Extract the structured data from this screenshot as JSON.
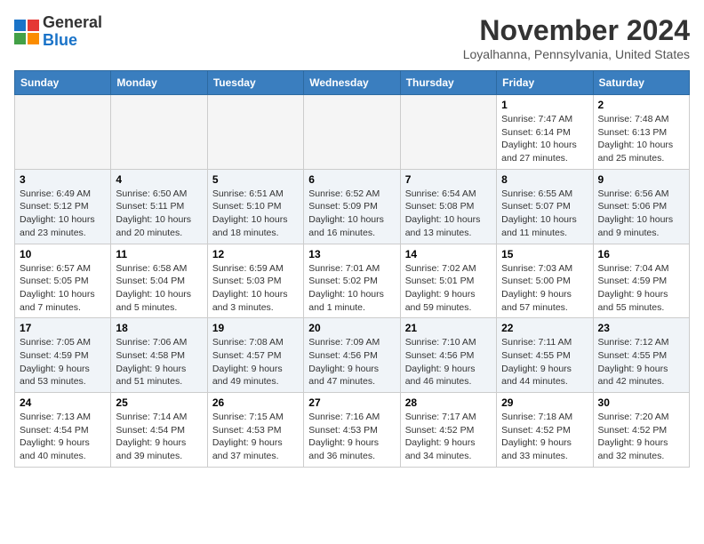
{
  "logo": {
    "general": "General",
    "blue": "Blue"
  },
  "header": {
    "month": "November 2024",
    "location": "Loyalhanna, Pennsylvania, United States"
  },
  "weekdays": [
    "Sunday",
    "Monday",
    "Tuesday",
    "Wednesday",
    "Thursday",
    "Friday",
    "Saturday"
  ],
  "weeks": [
    [
      {
        "day": "",
        "empty": true
      },
      {
        "day": "",
        "empty": true
      },
      {
        "day": "",
        "empty": true
      },
      {
        "day": "",
        "empty": true
      },
      {
        "day": "",
        "empty": true
      },
      {
        "day": "1",
        "sunrise": "Sunrise: 7:47 AM",
        "sunset": "Sunset: 6:14 PM",
        "daylight": "Daylight: 10 hours and 27 minutes."
      },
      {
        "day": "2",
        "sunrise": "Sunrise: 7:48 AM",
        "sunset": "Sunset: 6:13 PM",
        "daylight": "Daylight: 10 hours and 25 minutes."
      }
    ],
    [
      {
        "day": "3",
        "sunrise": "Sunrise: 6:49 AM",
        "sunset": "Sunset: 5:12 PM",
        "daylight": "Daylight: 10 hours and 23 minutes."
      },
      {
        "day": "4",
        "sunrise": "Sunrise: 6:50 AM",
        "sunset": "Sunset: 5:11 PM",
        "daylight": "Daylight: 10 hours and 20 minutes."
      },
      {
        "day": "5",
        "sunrise": "Sunrise: 6:51 AM",
        "sunset": "Sunset: 5:10 PM",
        "daylight": "Daylight: 10 hours and 18 minutes."
      },
      {
        "day": "6",
        "sunrise": "Sunrise: 6:52 AM",
        "sunset": "Sunset: 5:09 PM",
        "daylight": "Daylight: 10 hours and 16 minutes."
      },
      {
        "day": "7",
        "sunrise": "Sunrise: 6:54 AM",
        "sunset": "Sunset: 5:08 PM",
        "daylight": "Daylight: 10 hours and 13 minutes."
      },
      {
        "day": "8",
        "sunrise": "Sunrise: 6:55 AM",
        "sunset": "Sunset: 5:07 PM",
        "daylight": "Daylight: 10 hours and 11 minutes."
      },
      {
        "day": "9",
        "sunrise": "Sunrise: 6:56 AM",
        "sunset": "Sunset: 5:06 PM",
        "daylight": "Daylight: 10 hours and 9 minutes."
      }
    ],
    [
      {
        "day": "10",
        "sunrise": "Sunrise: 6:57 AM",
        "sunset": "Sunset: 5:05 PM",
        "daylight": "Daylight: 10 hours and 7 minutes."
      },
      {
        "day": "11",
        "sunrise": "Sunrise: 6:58 AM",
        "sunset": "Sunset: 5:04 PM",
        "daylight": "Daylight: 10 hours and 5 minutes."
      },
      {
        "day": "12",
        "sunrise": "Sunrise: 6:59 AM",
        "sunset": "Sunset: 5:03 PM",
        "daylight": "Daylight: 10 hours and 3 minutes."
      },
      {
        "day": "13",
        "sunrise": "Sunrise: 7:01 AM",
        "sunset": "Sunset: 5:02 PM",
        "daylight": "Daylight: 10 hours and 1 minute."
      },
      {
        "day": "14",
        "sunrise": "Sunrise: 7:02 AM",
        "sunset": "Sunset: 5:01 PM",
        "daylight": "Daylight: 9 hours and 59 minutes."
      },
      {
        "day": "15",
        "sunrise": "Sunrise: 7:03 AM",
        "sunset": "Sunset: 5:00 PM",
        "daylight": "Daylight: 9 hours and 57 minutes."
      },
      {
        "day": "16",
        "sunrise": "Sunrise: 7:04 AM",
        "sunset": "Sunset: 4:59 PM",
        "daylight": "Daylight: 9 hours and 55 minutes."
      }
    ],
    [
      {
        "day": "17",
        "sunrise": "Sunrise: 7:05 AM",
        "sunset": "Sunset: 4:59 PM",
        "daylight": "Daylight: 9 hours and 53 minutes."
      },
      {
        "day": "18",
        "sunrise": "Sunrise: 7:06 AM",
        "sunset": "Sunset: 4:58 PM",
        "daylight": "Daylight: 9 hours and 51 minutes."
      },
      {
        "day": "19",
        "sunrise": "Sunrise: 7:08 AM",
        "sunset": "Sunset: 4:57 PM",
        "daylight": "Daylight: 9 hours and 49 minutes."
      },
      {
        "day": "20",
        "sunrise": "Sunrise: 7:09 AM",
        "sunset": "Sunset: 4:56 PM",
        "daylight": "Daylight: 9 hours and 47 minutes."
      },
      {
        "day": "21",
        "sunrise": "Sunrise: 7:10 AM",
        "sunset": "Sunset: 4:56 PM",
        "daylight": "Daylight: 9 hours and 46 minutes."
      },
      {
        "day": "22",
        "sunrise": "Sunrise: 7:11 AM",
        "sunset": "Sunset: 4:55 PM",
        "daylight": "Daylight: 9 hours and 44 minutes."
      },
      {
        "day": "23",
        "sunrise": "Sunrise: 7:12 AM",
        "sunset": "Sunset: 4:55 PM",
        "daylight": "Daylight: 9 hours and 42 minutes."
      }
    ],
    [
      {
        "day": "24",
        "sunrise": "Sunrise: 7:13 AM",
        "sunset": "Sunset: 4:54 PM",
        "daylight": "Daylight: 9 hours and 40 minutes."
      },
      {
        "day": "25",
        "sunrise": "Sunrise: 7:14 AM",
        "sunset": "Sunset: 4:54 PM",
        "daylight": "Daylight: 9 hours and 39 minutes."
      },
      {
        "day": "26",
        "sunrise": "Sunrise: 7:15 AM",
        "sunset": "Sunset: 4:53 PM",
        "daylight": "Daylight: 9 hours and 37 minutes."
      },
      {
        "day": "27",
        "sunrise": "Sunrise: 7:16 AM",
        "sunset": "Sunset: 4:53 PM",
        "daylight": "Daylight: 9 hours and 36 minutes."
      },
      {
        "day": "28",
        "sunrise": "Sunrise: 7:17 AM",
        "sunset": "Sunset: 4:52 PM",
        "daylight": "Daylight: 9 hours and 34 minutes."
      },
      {
        "day": "29",
        "sunrise": "Sunrise: 7:18 AM",
        "sunset": "Sunset: 4:52 PM",
        "daylight": "Daylight: 9 hours and 33 minutes."
      },
      {
        "day": "30",
        "sunrise": "Sunrise: 7:20 AM",
        "sunset": "Sunset: 4:52 PM",
        "daylight": "Daylight: 9 hours and 32 minutes."
      }
    ]
  ]
}
